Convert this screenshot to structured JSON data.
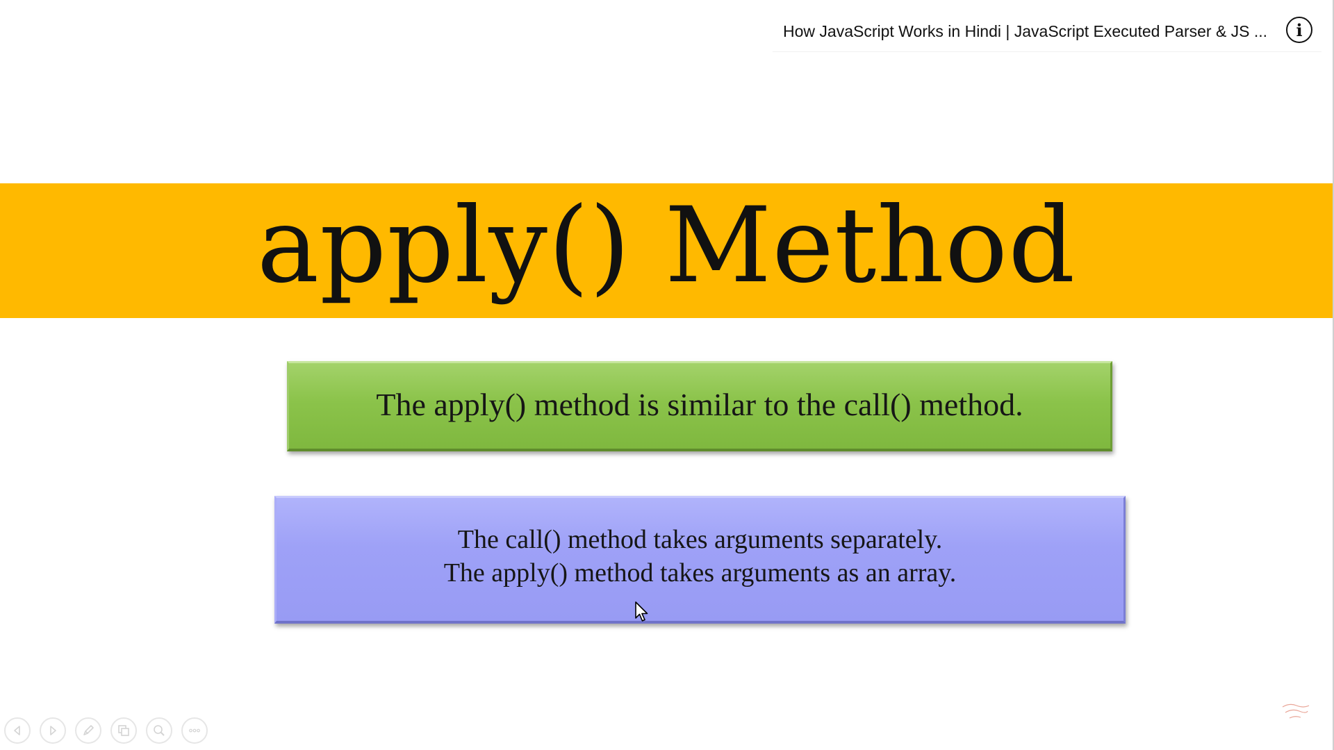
{
  "video": {
    "title": "How JavaScript Works in Hindi | JavaScript Executed Parser & JS ...",
    "info_icon": "info-icon"
  },
  "slide": {
    "title": "apply() Method",
    "band_color": "#ffb900",
    "green_box": {
      "text": "The apply() method is similar to the call() method.",
      "color": "#8bc34a"
    },
    "blue_box": {
      "lines": [
        "The call() method takes arguments separately.",
        "The apply() method takes arguments as an array."
      ],
      "color": "#9ea1f7"
    }
  },
  "controls": {
    "icons": [
      "previous-icon",
      "next-icon",
      "pen-icon",
      "slides-icon",
      "zoom-icon",
      "more-icon"
    ]
  },
  "watermark": {
    "logo": "channel-logo"
  }
}
